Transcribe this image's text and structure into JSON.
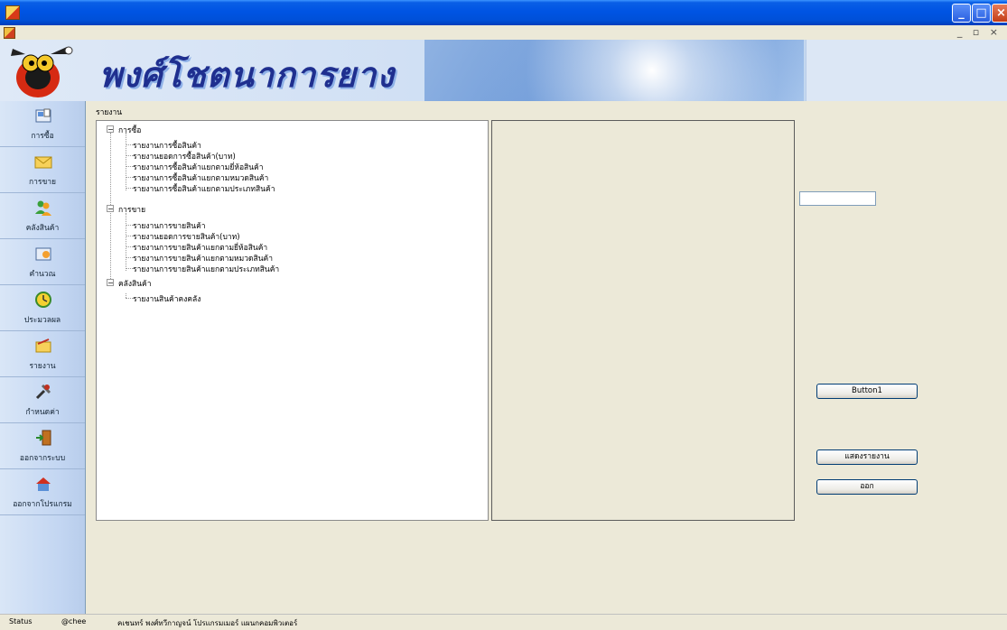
{
  "window": {
    "minimize": "_",
    "maximize": "□",
    "close": "×",
    "mdi_controls": "_ ▫ ×"
  },
  "banner": {
    "title": "พงศ์โชตนาการยาง"
  },
  "sidebar": {
    "items": [
      {
        "label": "การซื้อ",
        "icon": "purchase-icon"
      },
      {
        "label": "การขาย",
        "icon": "sale-envelope-icon"
      },
      {
        "label": "คลังสินค้า",
        "icon": "warehouse-users-icon"
      },
      {
        "label": "คำนวณ",
        "icon": "calculate-icon"
      },
      {
        "label": "ประมวลผล",
        "icon": "process-clock-icon"
      },
      {
        "label": "รายงาน",
        "icon": "report-icon"
      },
      {
        "label": "กำหนดค่า",
        "icon": "settings-tools-icon"
      },
      {
        "label": "ออกจากระบบ",
        "icon": "logout-door-icon"
      },
      {
        "label": "ออกจากโปรแกรม",
        "icon": "exit-home-icon"
      }
    ]
  },
  "main": {
    "groupbox_label": "รายงาน",
    "tree": [
      {
        "label": "การซื้อ",
        "children": [
          "รายงานการซื้อสินค้า",
          "รายงานยอดการซื้อสินค้า(บาท)",
          "รายงานการซื้อสินค้าแยกตามยี่ห้อสินค้า",
          "รายงานการซื้อสินค้าแยกตามหมวดสินค้า",
          "รายงานการซื้อสินค้าแยกตามประเภทสินค้า"
        ]
      },
      {
        "label": "การขาย",
        "children": [
          "รายงานการขายสินค้า",
          "รายงานยอดการขายสินค้า(บาท)",
          "รายงานการขายสินค้าแยกตามยี่ห้อสินค้า",
          "รายงานการขายสินค้าแยกตามหมวดสินค้า",
          "รายงานการขายสินค้าแยกตามประเภทสินค้า"
        ]
      },
      {
        "label": "คลังสินค้า",
        "children": [
          "รายงานสินค้าคงคลัง"
        ]
      }
    ],
    "textbox_value": "",
    "button1_label": "Button1",
    "show_report_label": "แสดงรายงาน",
    "exit_label": "ออก"
  },
  "status": {
    "label": "Status",
    "user": "@chee",
    "developer": "คเชนทร์ พงศ์ทวีกาญจน์  โปรแกรมเมอร์  แผนกคอมพิวเตอร์"
  }
}
